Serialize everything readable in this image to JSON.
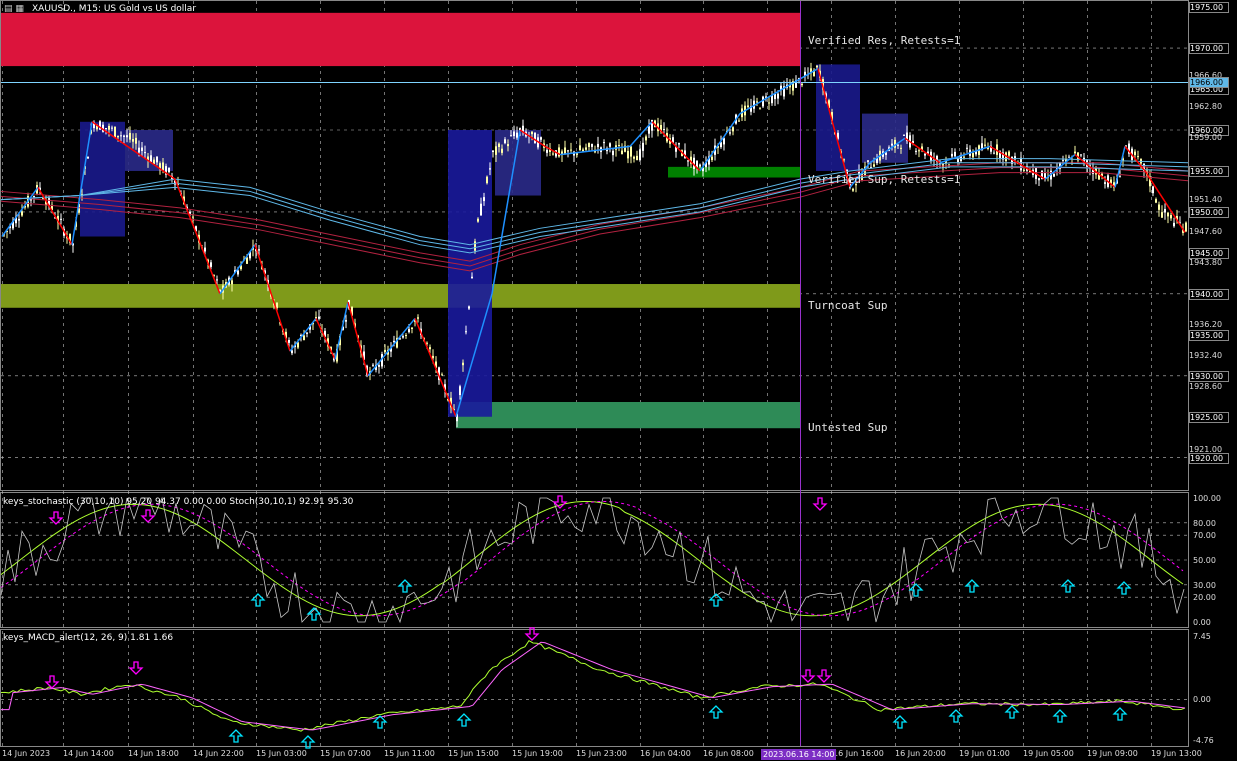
{
  "main": {
    "title": "XAUUSD., M15:  US Gold vs US dollar",
    "zones": [
      {
        "label": "Verified Res, Retests=1",
        "color": "#dc143c",
        "top": 1974.3,
        "bottom": 1967.8
      },
      {
        "label": "Verified Sup, Retests=1",
        "color": "#008000",
        "top": 1955.5,
        "bottom": 1954.2
      },
      {
        "label": "Turncoat Sup",
        "color": "#7f9a1a",
        "top": 1941.2,
        "bottom": 1938.3
      },
      {
        "label": "Untested Sup",
        "color": "#2e8b57",
        "top": 1926.8,
        "bottom": 1923.6
      }
    ],
    "price_axis": [
      "1975.00",
      "1970.00",
      "1966.60",
      "1965.00",
      "1962.80",
      "1960.00",
      "1959.00",
      "1955.00",
      "1951.40",
      "1950.00",
      "1947.60",
      "1945.00",
      "1943.80",
      "1940.00",
      "1936.20",
      "1935.00",
      "1932.40",
      "1930.00",
      "1928.60",
      "1925.00",
      "1921.00",
      "1920.00"
    ],
    "boxed_prices": [
      "1975.00",
      "1970.00",
      "1965.00",
      "1960.00",
      "1955.00",
      "1950.00",
      "1945.00",
      "1940.00",
      "1935.00",
      "1930.00",
      "1925.00",
      "1920.00"
    ],
    "current_price": "1966.00",
    "ylim": [
      1918.5,
      1975.5
    ]
  },
  "stochastic": {
    "title": "keys_stochastic (30,10,10) 95.20 94.37 0.00 0.00 Stoch(30,10,1) 92.91 95.30",
    "axis": [
      "100.00",
      "80.00",
      "70.00",
      "50.00",
      "30.00",
      "20.00",
      "0.00"
    ],
    "ylim": [
      0,
      100
    ]
  },
  "macd": {
    "title": "keys_MACD_alert(12, 26, 9) 1.81 1.66",
    "axis": [
      "7.45",
      "0.00",
      "-4.76"
    ],
    "ylim": [
      -4.76,
      7.45
    ]
  },
  "time_axis": [
    "14 Jun 2023",
    "14 Jun 14:00",
    "14 Jun 18:00",
    "14 Jun 22:00",
    "15 Jun 03:00",
    "15 Jun 07:00",
    "15 Jun 11:00",
    "15 Jun 15:00",
    "15 Jun 19:00",
    "15 Jun 23:00",
    "16 Jun 04:00",
    "16 Jun 08:00",
    "16 Jun 16:00",
    "16 Jun 20:00",
    "19 Jun 01:00",
    "19 Jun 05:00",
    "19 Jun 09:00",
    "19 Jun 13:00"
  ],
  "crosshair_time": "2023.06.16 14:00",
  "colors": {
    "background": "#000000",
    "grid": "#c0c0c0",
    "bull_candle": "#ffffaa",
    "bear_candle": "#ffffff",
    "zigzag_up": "#1e90ff",
    "zigzag_down": "#ff0000",
    "ma_red": "#b22240",
    "ma_blue": "#5fb8e8",
    "stoch_main": "#c8c8c8",
    "stoch_signal": "#adff2f",
    "stoch_dashed": "#ff00ff",
    "macd_main": "#adff2f",
    "macd_signal": "#ff66ff",
    "arrow_up": "#00e5ff",
    "arrow_down": "#ff00ff"
  }
}
